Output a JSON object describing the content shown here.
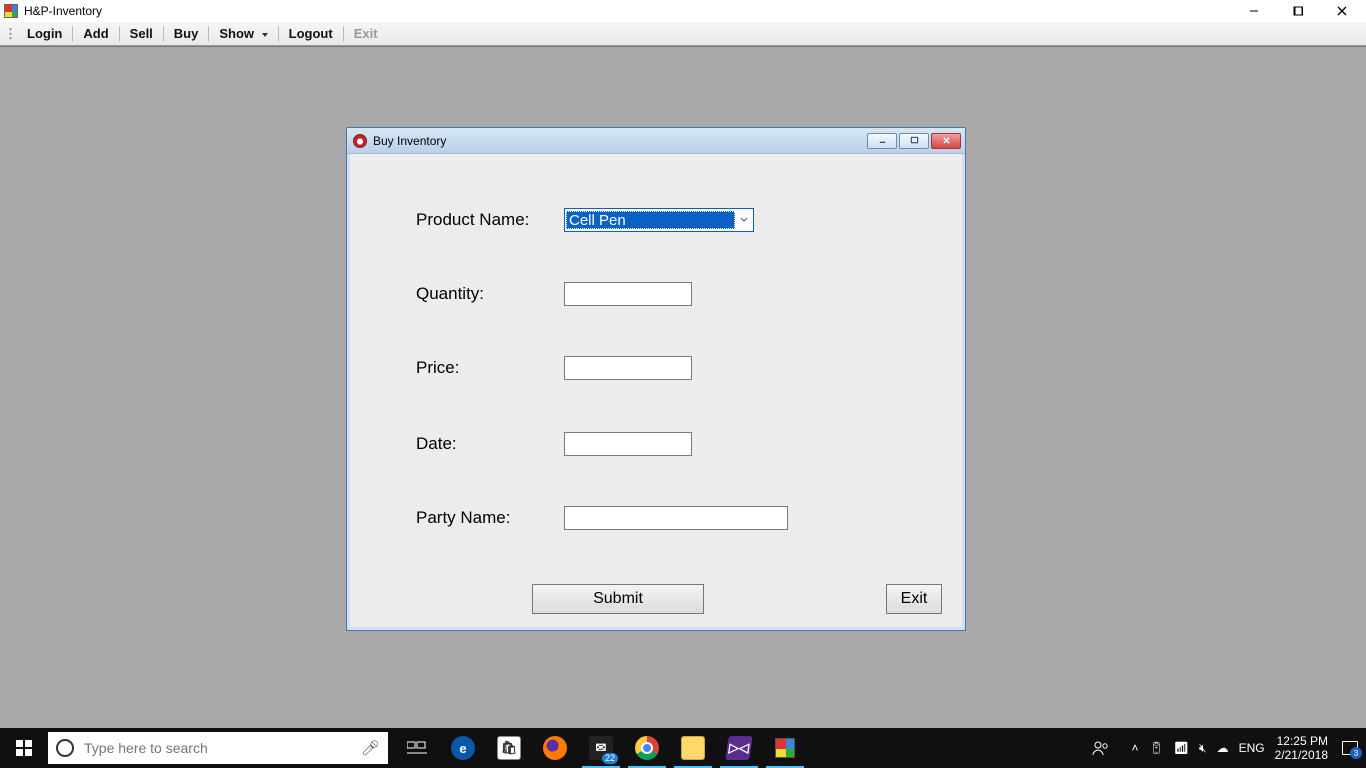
{
  "parent_window": {
    "title": "H&P-Inventory"
  },
  "menu": {
    "items": [
      {
        "label": "Login",
        "enabled": true,
        "dropdown": false
      },
      {
        "label": "Add",
        "enabled": true,
        "dropdown": false
      },
      {
        "label": "Sell",
        "enabled": true,
        "dropdown": false
      },
      {
        "label": "Buy",
        "enabled": true,
        "dropdown": false
      },
      {
        "label": "Show",
        "enabled": true,
        "dropdown": true
      },
      {
        "label": "Logout",
        "enabled": true,
        "dropdown": false
      },
      {
        "label": "Exit",
        "enabled": false,
        "dropdown": false
      }
    ]
  },
  "dialog": {
    "title": "Buy Inventory",
    "fields": {
      "product_name": {
        "label": "Product Name:",
        "value": "Cell Pen"
      },
      "quantity": {
        "label": "Quantity:",
        "value": ""
      },
      "price": {
        "label": "Price:",
        "value": ""
      },
      "date": {
        "label": "Date:",
        "value": ""
      },
      "party_name": {
        "label": "Party Name:",
        "value": ""
      }
    },
    "buttons": {
      "submit": "Submit",
      "exit": "Exit"
    }
  },
  "taskbar": {
    "search_placeholder": "Type here to search",
    "mail_badge": "22",
    "lang": "ENG",
    "time": "12:25 PM",
    "date": "2/21/2018",
    "notif_badge": "3"
  }
}
